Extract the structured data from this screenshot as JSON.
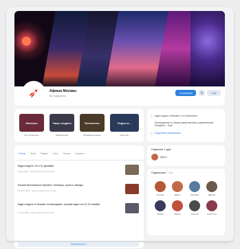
{
  "community": {
    "name": "Афиша Москвы",
    "status": "Вы подписаны",
    "logo_icon": "red-arrow-logo-icon"
  },
  "header_actions": {
    "message_label": "Сообщения",
    "settings_icon": "gear-icon",
    "more_label": "Ещё"
  },
  "chips": [
    {
      "label": "Фильмы",
      "caption": "Что посмотреть",
      "color": "#6a2a3a"
    },
    {
      "label": "Чаще сходить",
      "caption": "Подписчиком",
      "color": "#3a3a4a"
    },
    {
      "label": "Бесплатно",
      "caption": "Музейные недели",
      "color": "#4a3a2a"
    },
    {
      "label": "Отдых в…",
      "caption": "Куда пой…",
      "color": "#2a3a5a"
    }
  ],
  "info": {
    "line1": "Куда сходить в Москве и что посмотреть",
    "line2": "Путеводитель по самым ярким местам и развлечениям. Концерты… Ещё",
    "line3": "Подробная информация"
  },
  "feed": {
    "tabs": [
      "Статьи",
      "Фото",
      "Видео",
      "Чаты",
      "Клипы",
      "Сюжеты"
    ],
    "posts": [
      {
        "title": "Куда сходить 10 и 11 декабря",
        "meta": "8 дек 2023 · минута минуты на чтение",
        "thumb_color": "#7a6a5a"
      },
      {
        "title": "Башни Московского Кремля: темницы, орлы и звезды",
        "meta": "16 мая 2023 · минуты минуты на чтение",
        "thumb_color": "#8a3a2a"
      },
      {
        "title": "Куда сходить в Москве на выходные: лучшие идеи на 12-13 ноября",
        "meta": "11 ноя 2023 · минут минуты на чтение",
        "thumb_color": "#5a5a6a"
      }
    ],
    "show_all": "Показать все 4"
  },
  "friend": {
    "title": "Подписан 1 друг",
    "name": "Дарья"
  },
  "subscribers": {
    "title": "Подписчики",
    "count": "7 916",
    "people": [
      {
        "name": "Татьяна",
        "color": "#b5583a"
      },
      {
        "name": "Дарья",
        "color": "#c06a4a"
      },
      {
        "name": "Зинаида",
        "color": "#5a7aa0"
      },
      {
        "name": "Данияр",
        "color": "#6a5a4a"
      },
      {
        "name": "Мария",
        "color": "#3a3a5a"
      },
      {
        "name": "Мария",
        "color": "#c0503a"
      },
      {
        "name": "Георгий",
        "color": "#4a4a4a"
      },
      {
        "name": "Кристина",
        "color": "#8a3a4a"
      }
    ]
  }
}
